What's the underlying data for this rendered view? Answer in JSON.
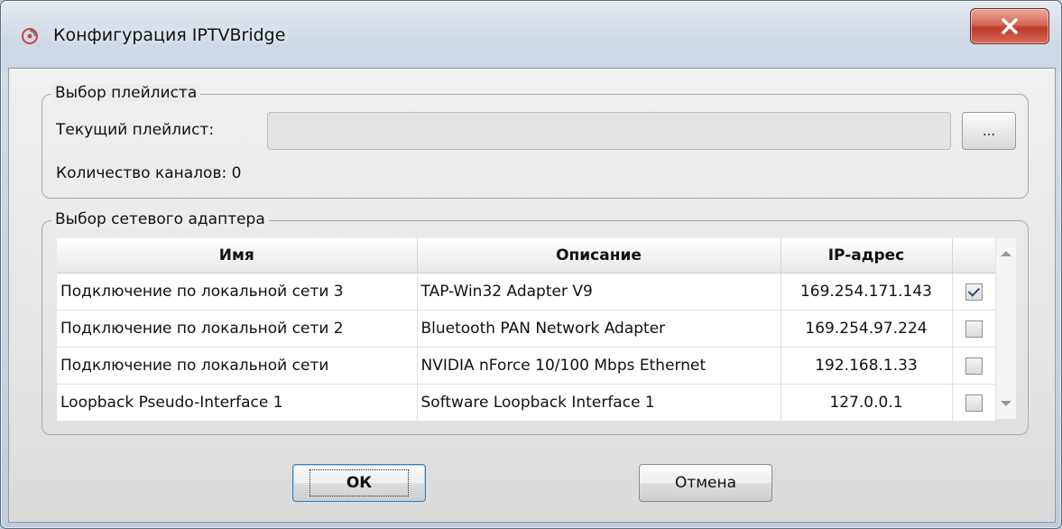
{
  "window": {
    "title": "Конфигурация IPTVBridge",
    "close_glyph": "X"
  },
  "playlist_group": {
    "legend": "Выбор плейлиста",
    "current_label": "Текущий плейлист:",
    "current_value": "",
    "browse_label": "...",
    "channels_label": "Количество каналов:",
    "channels_count": "0"
  },
  "adapter_group": {
    "legend": "Выбор сетевого адаптера",
    "columns": [
      "Имя",
      "Описание",
      "IP-адрес",
      ""
    ],
    "rows": [
      {
        "name": "Подключение по локальной сети 3",
        "description": "TAP-Win32 Adapter V9",
        "ip": "169.254.171.143",
        "selected": true
      },
      {
        "name": "Подключение по локальной сети 2",
        "description": "Bluetooth PAN Network Adapter",
        "ip": "169.254.97.224",
        "selected": false
      },
      {
        "name": "Подключение по локальной сети",
        "description": "NVIDIA nForce 10/100 Mbps Ethernet",
        "ip": "192.168.1.33",
        "selected": false
      },
      {
        "name": "Loopback Pseudo-Interface 1",
        "description": "Software Loopback Interface 1",
        "ip": "127.0.0.1",
        "selected": false
      }
    ]
  },
  "buttons": {
    "ok": "ОК",
    "cancel": "Отмена"
  },
  "icons": {
    "app": "app-swirl-icon",
    "close": "close-icon",
    "scroll_up": "scroll-up-arrow-icon",
    "scroll_down": "scroll-down-arrow-icon"
  },
  "colors": {
    "close_button": "#c0392b",
    "focus_border": "#3c7fb1"
  }
}
